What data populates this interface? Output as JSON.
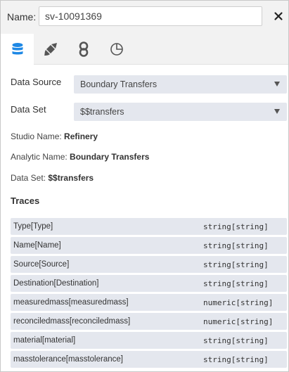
{
  "header": {
    "name_label": "Name:",
    "name_value": "sv-10091369"
  },
  "tabs": [
    {
      "icon": "database-icon",
      "active": true
    },
    {
      "icon": "paint-brush-icon",
      "active": false
    },
    {
      "icon": "link-icon",
      "active": false
    },
    {
      "icon": "pie-chart-icon",
      "active": false
    }
  ],
  "form": {
    "data_source_label": "Data Source",
    "data_source_value": "Boundary Transfers",
    "data_set_label": "Data Set",
    "data_set_value": "$$transfers"
  },
  "info": {
    "studio_label": "Studio Name:",
    "studio_value": "Refinery",
    "analytic_label": "Analytic Name:",
    "analytic_value": "Boundary Transfers",
    "dataset_label": "Data Set:",
    "dataset_value": "$$transfers"
  },
  "traces": {
    "title": "Traces",
    "items": [
      {
        "name": "Type[Type]",
        "type": "string[string]"
      },
      {
        "name": "Name[Name]",
        "type": "string[string]"
      },
      {
        "name": "Source[Source]",
        "type": "string[string]"
      },
      {
        "name": "Destination[Destination]",
        "type": "string[string]"
      },
      {
        "name": "measuredmass[measuredmass]",
        "type": "numeric[string]"
      },
      {
        "name": "reconciledmass[reconciledmass]",
        "type": "numeric[string]"
      },
      {
        "name": "material[material]",
        "type": "string[string]"
      },
      {
        "name": "masstolerance[masstolerance]",
        "type": "string[string]"
      }
    ]
  },
  "colors": {
    "accent": "#1e88e5",
    "icon_gray": "#555555",
    "header_bg": "#f2f2f2",
    "field_bg": "#e4e7ee"
  }
}
